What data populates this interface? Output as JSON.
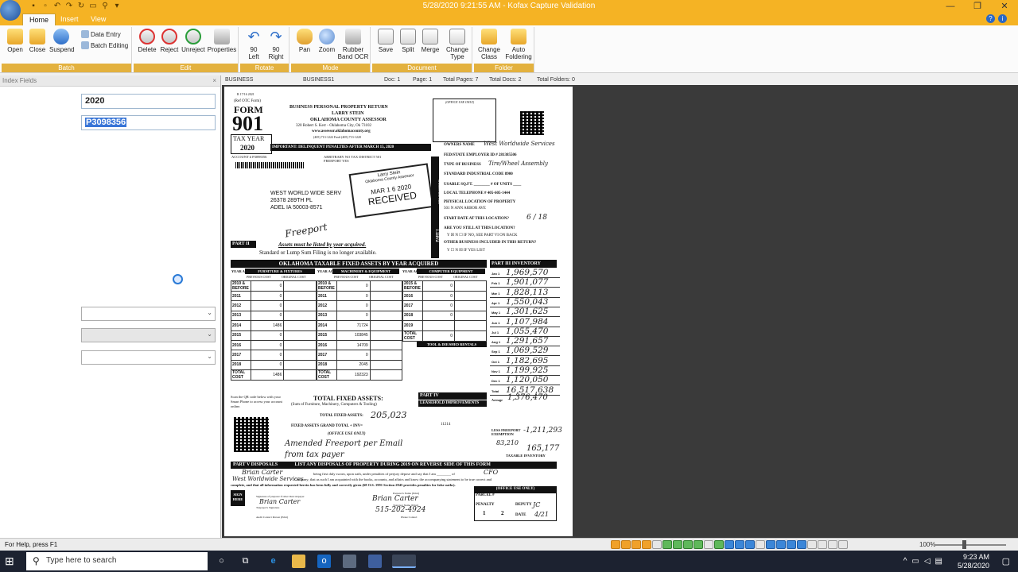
{
  "window": {
    "title": "5/28/2020 9:21:55 AM - Kofax Capture Validation",
    "minimize": "—",
    "restore": "❐",
    "close": "✕"
  },
  "tabs": [
    "Home",
    "Insert",
    "View"
  ],
  "ribbon": {
    "batch": {
      "label": "Batch",
      "open": "Open",
      "close": "Close",
      "suspend": "Suspend",
      "data_entry": "Data Entry",
      "batch_editing": "Batch Editing"
    },
    "edit": {
      "label": "Edit",
      "delete": "Delete",
      "reject": "Reject",
      "unreject": "Unreject",
      "properties": "Properties"
    },
    "rotate": {
      "label": "Rotate",
      "left": "90\nLeft",
      "right": "90\nRight"
    },
    "mode": {
      "label": "Mode",
      "pan": "Pan",
      "zoom": "Zoom",
      "rubber_band": "Rubber\nBand OCR"
    },
    "document": {
      "label": "Document",
      "save": "Save",
      "split": "Split",
      "merge": "Merge",
      "change_type": "Change\nType"
    },
    "folder": {
      "label": "Folder",
      "change_class": "Change\nClass",
      "auto_foldering": "Auto\nFoldering"
    }
  },
  "index_panel": {
    "title": "Index Fields",
    "close": "×",
    "field1": "2020",
    "field2": "P3098356"
  },
  "docbar": {
    "batch_class": "BUSINESS",
    "batch": "BUSINESS1",
    "doc": "Doc: 1",
    "page": "Page: 1",
    "total_pages": "Total Pages: 7",
    "total_docs": "Total Docs: 2",
    "total_folders": "Total Folders: 0"
  },
  "form": {
    "rev": "R 17/16  2021",
    "ref": "(Ref OTC Form)",
    "form_label": "FORM",
    "form_number": "901",
    "tax_year_label": "TAX YEAR",
    "tax_year": "2020",
    "header1": "BUSINESS PERSONAL PROPERTY RETURN",
    "header2": "LARRY STEIN",
    "header3": "OKLAHOMA COUNTY ASSESSOR",
    "header4": "320 Robert S. Kerr - Oklahoma City, Ok 73102",
    "header5": "www.assessor.oklahomacounty.org",
    "header6": "(405) 713-1222    Fax# (405) 713-1220",
    "office_use": "(OFFICE USE ONLY)",
    "important": "IMPORTANT: DELINQUENT PENALTIES AFTER MARCH 15, 2020",
    "account": "ACCOUNT #  P3098356",
    "arbitrary": "ARBITRARY  NO   TAX DISTRICT   501",
    "freeport": "FREEPORT    YES",
    "addr1": "WEST WORLD WIDE SERV",
    "addr2": "26378 289TH PL",
    "addr3": "ADEL IA 50003-8571",
    "stamp1": "Larry Stein",
    "stamp2": "Oklahoma County Assessor",
    "stamp3": "MAR 1 6 2020",
    "stamp4": "RECEIVED",
    "freeport_hw": "Freeport",
    "start_here": "START HERE",
    "part1": "PART I",
    "owners_name": "OWNERS NAME",
    "owners_name_hw": "West Worldwide Services",
    "fein": "FED/STATE EMPLOYER ID # 281385506",
    "type_business": "TYPE OF BUSINESS",
    "type_business_hw": "Tire/Wheel Assembly",
    "sic": "STANDARD INDUSTRIAL CODE  8900",
    "usable": "USABLE SQ.FT. ________  # OF UNITS ____",
    "phone": "LOCAL TELEPHONE #  405-605-1444",
    "phys_loc": "PHYSICAL LOCATION OF PROPERTY",
    "phys_addr": "501 N ANN ARBOR AVE",
    "start_date": "START DATE AT THIS LOCATION?",
    "start_date_hw": "6 / 18",
    "still_at": "ARE YOU STILL AT THIS LOCATION?",
    "yn1": "Y ☒ N ☐   IF NO, SEE PART VI ON BACK",
    "other_business": "OTHER BUSINESS INCLUDED IN THIS RETURN?",
    "yn2": "Y ☐ N ☒  IF YES LIST",
    "part2": "PART II",
    "part2_text": "Assets must be listed by year acquired.",
    "part2_text2": "Standard or Lump Sum Filing is no longer available.",
    "ok_title": "OKLAHOMA TAXABLE FIXED ASSETS BY YEAR ACQUIRED",
    "col_furn": "FURNITURE & FIXTURES",
    "col_mach": "MACHINERY & EQUIPMENT",
    "col_comp": "COMPUTER EQUIPMENT",
    "col_tools": "TOOL & DIE/SHED RENTALS",
    "prev_cost": "PREVIOUS COST",
    "orig_cost": "ORIGINAL COST",
    "year_acq": "YEAR ACQ.",
    "part3": "PART III   INVENTORY",
    "inventory": [
      "1,969,570",
      "1,901,077",
      "1,828,113",
      "1,550,043",
      "1,301,625",
      "1,107,984",
      "1,055,470",
      "1,291,657",
      "1,069,529",
      "1,182,695",
      "1,199,925",
      "1,120,050",
      "16,517,638"
    ],
    "inv_months": [
      "Jan 1",
      "Feb 1",
      "Mar 1",
      "Apr 1",
      "May 1",
      "Jun 1",
      "Jul 1",
      "Aug 1",
      "Sep 1",
      "Oct 1",
      "Nov 1",
      "Dec 1",
      "Total"
    ],
    "average": "Average",
    "average_hw": "1,376,470",
    "total_fixed": "TOTAL FIXED ASSETS:",
    "total_fixed_sub": "(Sum of Furniture, Machinery, Computers & Tooling)",
    "total_fixed_assets_lbl": "TOTAL FIXED ASSETS:",
    "total_fixed_hw": "205,023",
    "grand_total": "FIXED ASSETS GRAND TOTAL + INV=",
    "office_use2": "(OFFICE USE ONLY)",
    "amended_hw": "Amended Freeport per Email",
    "amended_hw2": "from tax payer",
    "part4": "PART IV",
    "leasehold": "LEASEHOLD IMPROVEMENTS",
    "leasehold_val": "11214",
    "less_freeport": "LESS FREEPORT EXEMPTION",
    "less_freeport_hw": "-1,211,293",
    "taxable_inv": "TAXABLE INVENTORY",
    "taxable_hw": "165,177",
    "hw_83210": "83,210",
    "qr_text": "Scan the QR code below with your Smart Phone to access your account online.",
    "part5": "PART V  DISPOSALS",
    "part5_text": "LIST ANY DISPOSALS OF PROPERTY DURING 2019 ON REVERSE SIDE OF THIS FORM",
    "oath_hw1": "Brian Carter",
    "oath_hw2": "CFO",
    "oath_hw3": "West Worldwide Services",
    "oath_line1": "being first duly sworn, upon oath, under penalties of perjury depose and say that I am ________ of",
    "oath_line2": "Company; that as such I am acquainted with the books, accounts, and affairs and know the accompanying statement to be true correct and",
    "oath_line3": "complete, and that all information requested herein has been fully and correctly given (68 O.S. 1991 Section 2945 provides penalties for false oaths).",
    "sign_here": "SIGN HERE",
    "preparer": "Signature of preparer if other than taxpayer",
    "taxpayer_sig": "Taxpayer's Signature",
    "audit": "Audit Contact Person (Print)",
    "preparer_name": "Preparer's Name (Print)",
    "taxpayer_name": "Taxpayer Name (Print)",
    "phone_contact": "Phone Contact",
    "sig_hw": "Brian Carter",
    "phone_hw": "515-202-4924",
    "sig_hw2": "Brian Carter",
    "office_use3": "(OFFICE USE ONLY)",
    "parcel": "PARCEL #",
    "penalty": "PENALTY",
    "deputy": "DEPUTY",
    "deputy_hw": "JC",
    "date_lbl": "DATE",
    "date_hw": "4/21",
    "pen1": "1",
    "pen2": "2"
  },
  "grid_years": [
    "2010 & BEFORE",
    "2011",
    "2012",
    "2013",
    "2014",
    "2015",
    "2016",
    "2017",
    "2018",
    "TOTAL COST"
  ],
  "furniture_values": [
    "0",
    "0",
    "0",
    "0",
    "1486",
    "0",
    "0",
    "0",
    "0",
    "1486"
  ],
  "machinery_values": [
    "0",
    "0",
    "0",
    "0",
    "71724",
    "103845",
    "14709",
    "0",
    "2045",
    "192323"
  ],
  "computer_years": [
    "2015 & BEFORE",
    "2016",
    "2017",
    "2018",
    "2019",
    "TOTAL COST"
  ],
  "computer_values": [
    "0",
    "0",
    "0",
    "0",
    "",
    "0"
  ],
  "status": {
    "help": "For Help, press F1",
    "zoom": "100%"
  },
  "taskbar": {
    "search_placeholder": "Type here to search",
    "time": "9:23 AM",
    "date": "5/28/2020"
  }
}
